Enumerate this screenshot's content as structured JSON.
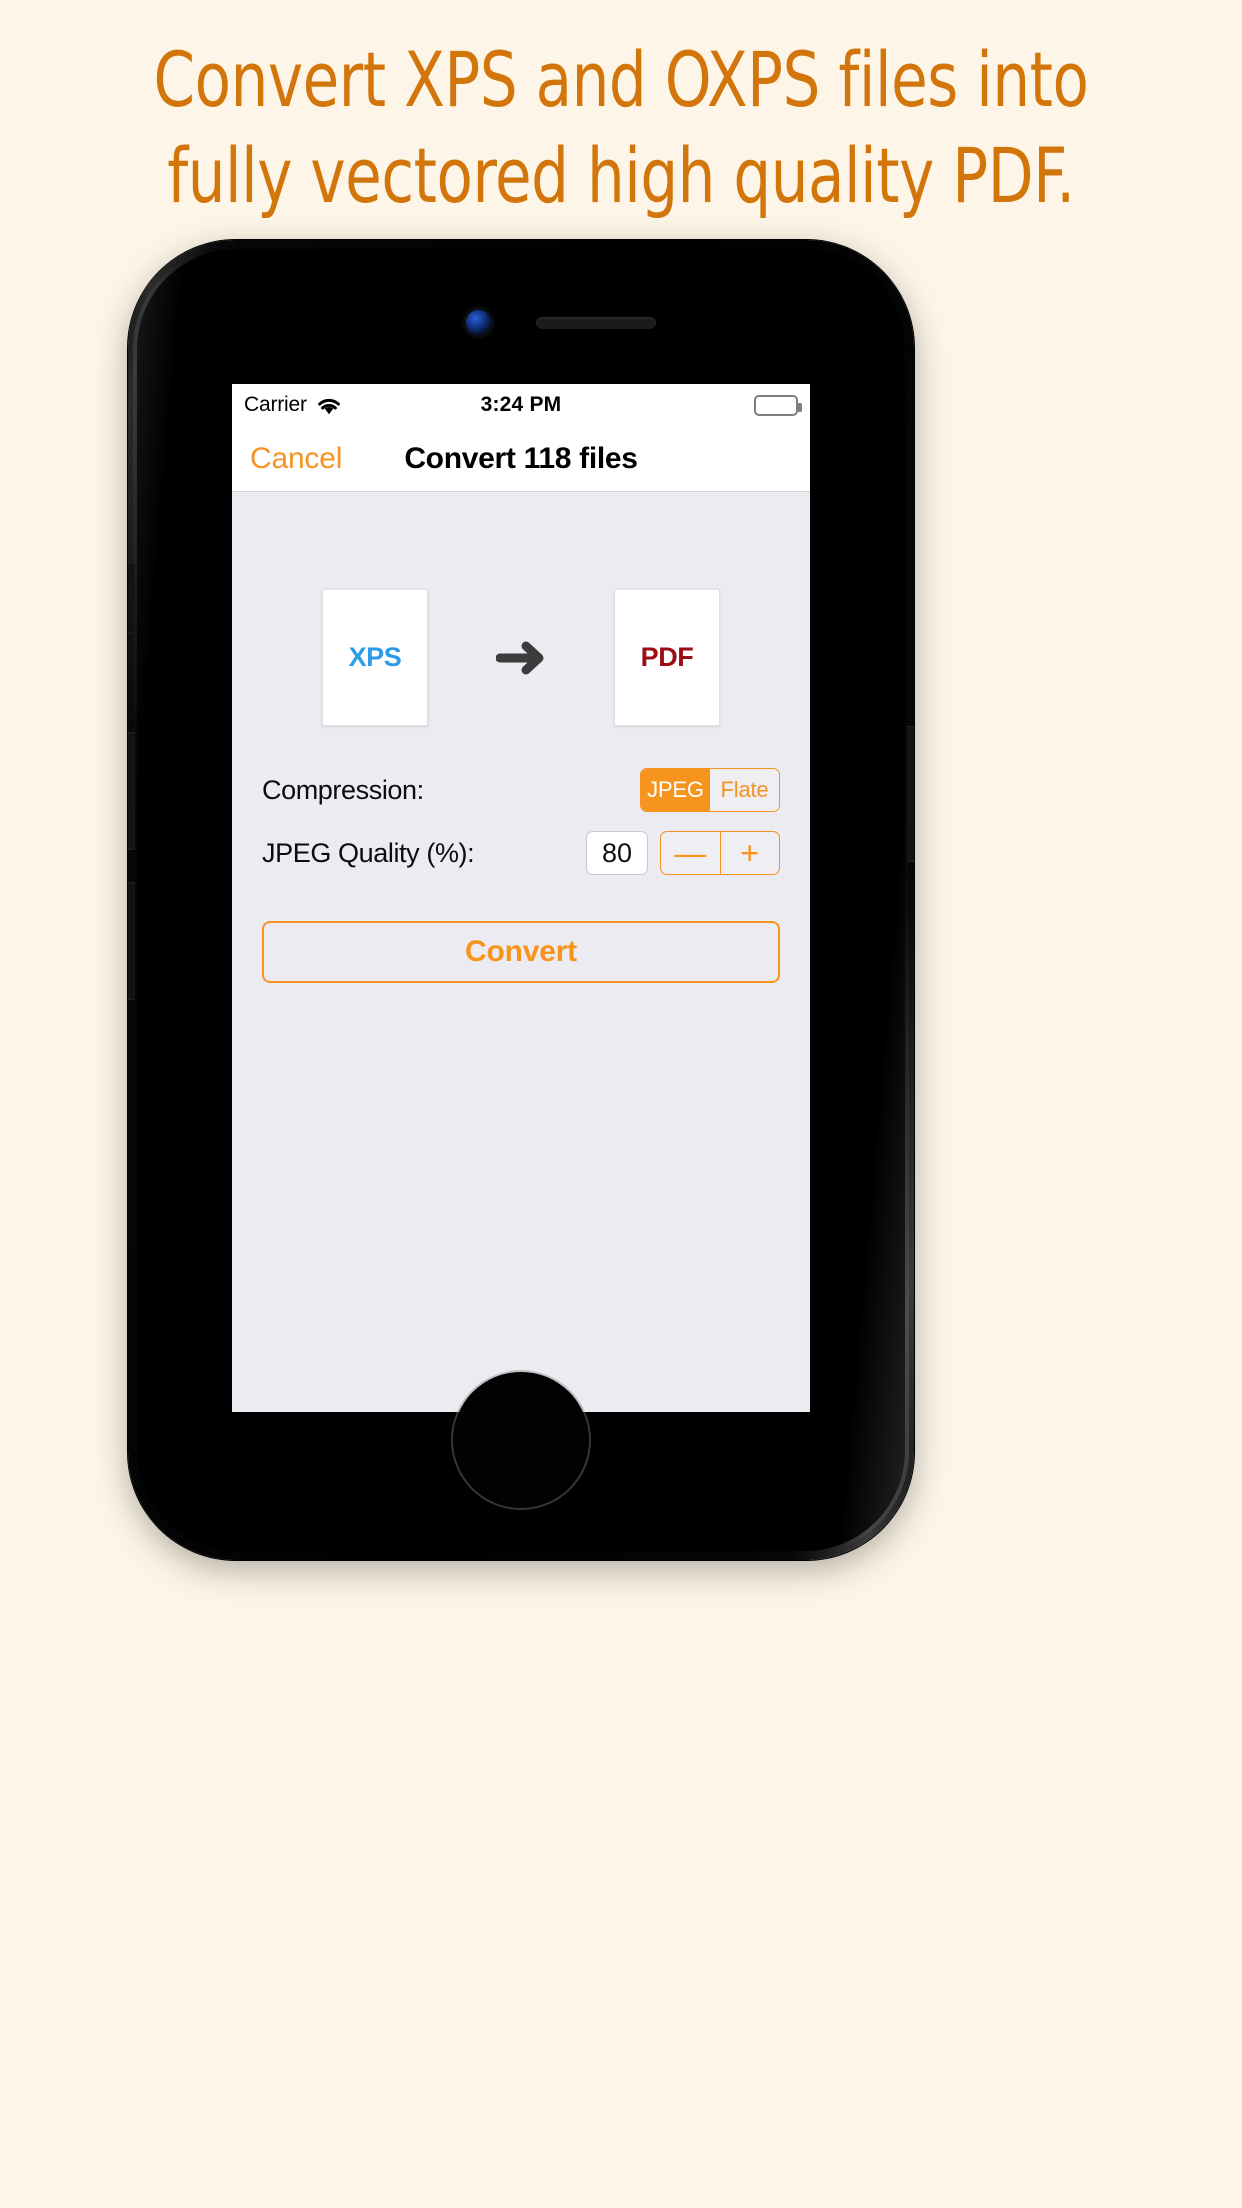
{
  "headline": {
    "line1": "Convert XPS and OXPS files into",
    "line2": "fully vectored high quality PDF.",
    "color": "#D2760B"
  },
  "device": {
    "icons": {
      "camera": "front-camera-icon",
      "speaker": "earpiece-speaker-icon",
      "home": "home-button-icon"
    }
  },
  "status_bar": {
    "carrier": "Carrier",
    "wifi_icon": "wifi-icon",
    "time": "3:24 PM",
    "battery_icon": "battery-full-icon",
    "battery_level": "100"
  },
  "nav_bar": {
    "cancel_label": "Cancel",
    "title": "Convert 118 files"
  },
  "conversion": {
    "source": {
      "label": "XPS",
      "color": "#2E9BE8"
    },
    "arrow_icon": "arrow-right-icon",
    "target": {
      "label": "PDF",
      "color": "#9C0E16"
    }
  },
  "form": {
    "compression": {
      "label": "Compression:",
      "options": [
        "JPEG",
        "Flate"
      ],
      "selected": "JPEG"
    },
    "jpeg_quality": {
      "label": "JPEG Quality (%):",
      "value": "80",
      "decrement_label": "—",
      "increment_label": "+"
    }
  },
  "actions": {
    "convert_label": "Convert"
  },
  "colors": {
    "accent_orange": "#F7941E",
    "screen_bg": "#EBEBF1",
    "page_bg": "#FDF6E8"
  }
}
